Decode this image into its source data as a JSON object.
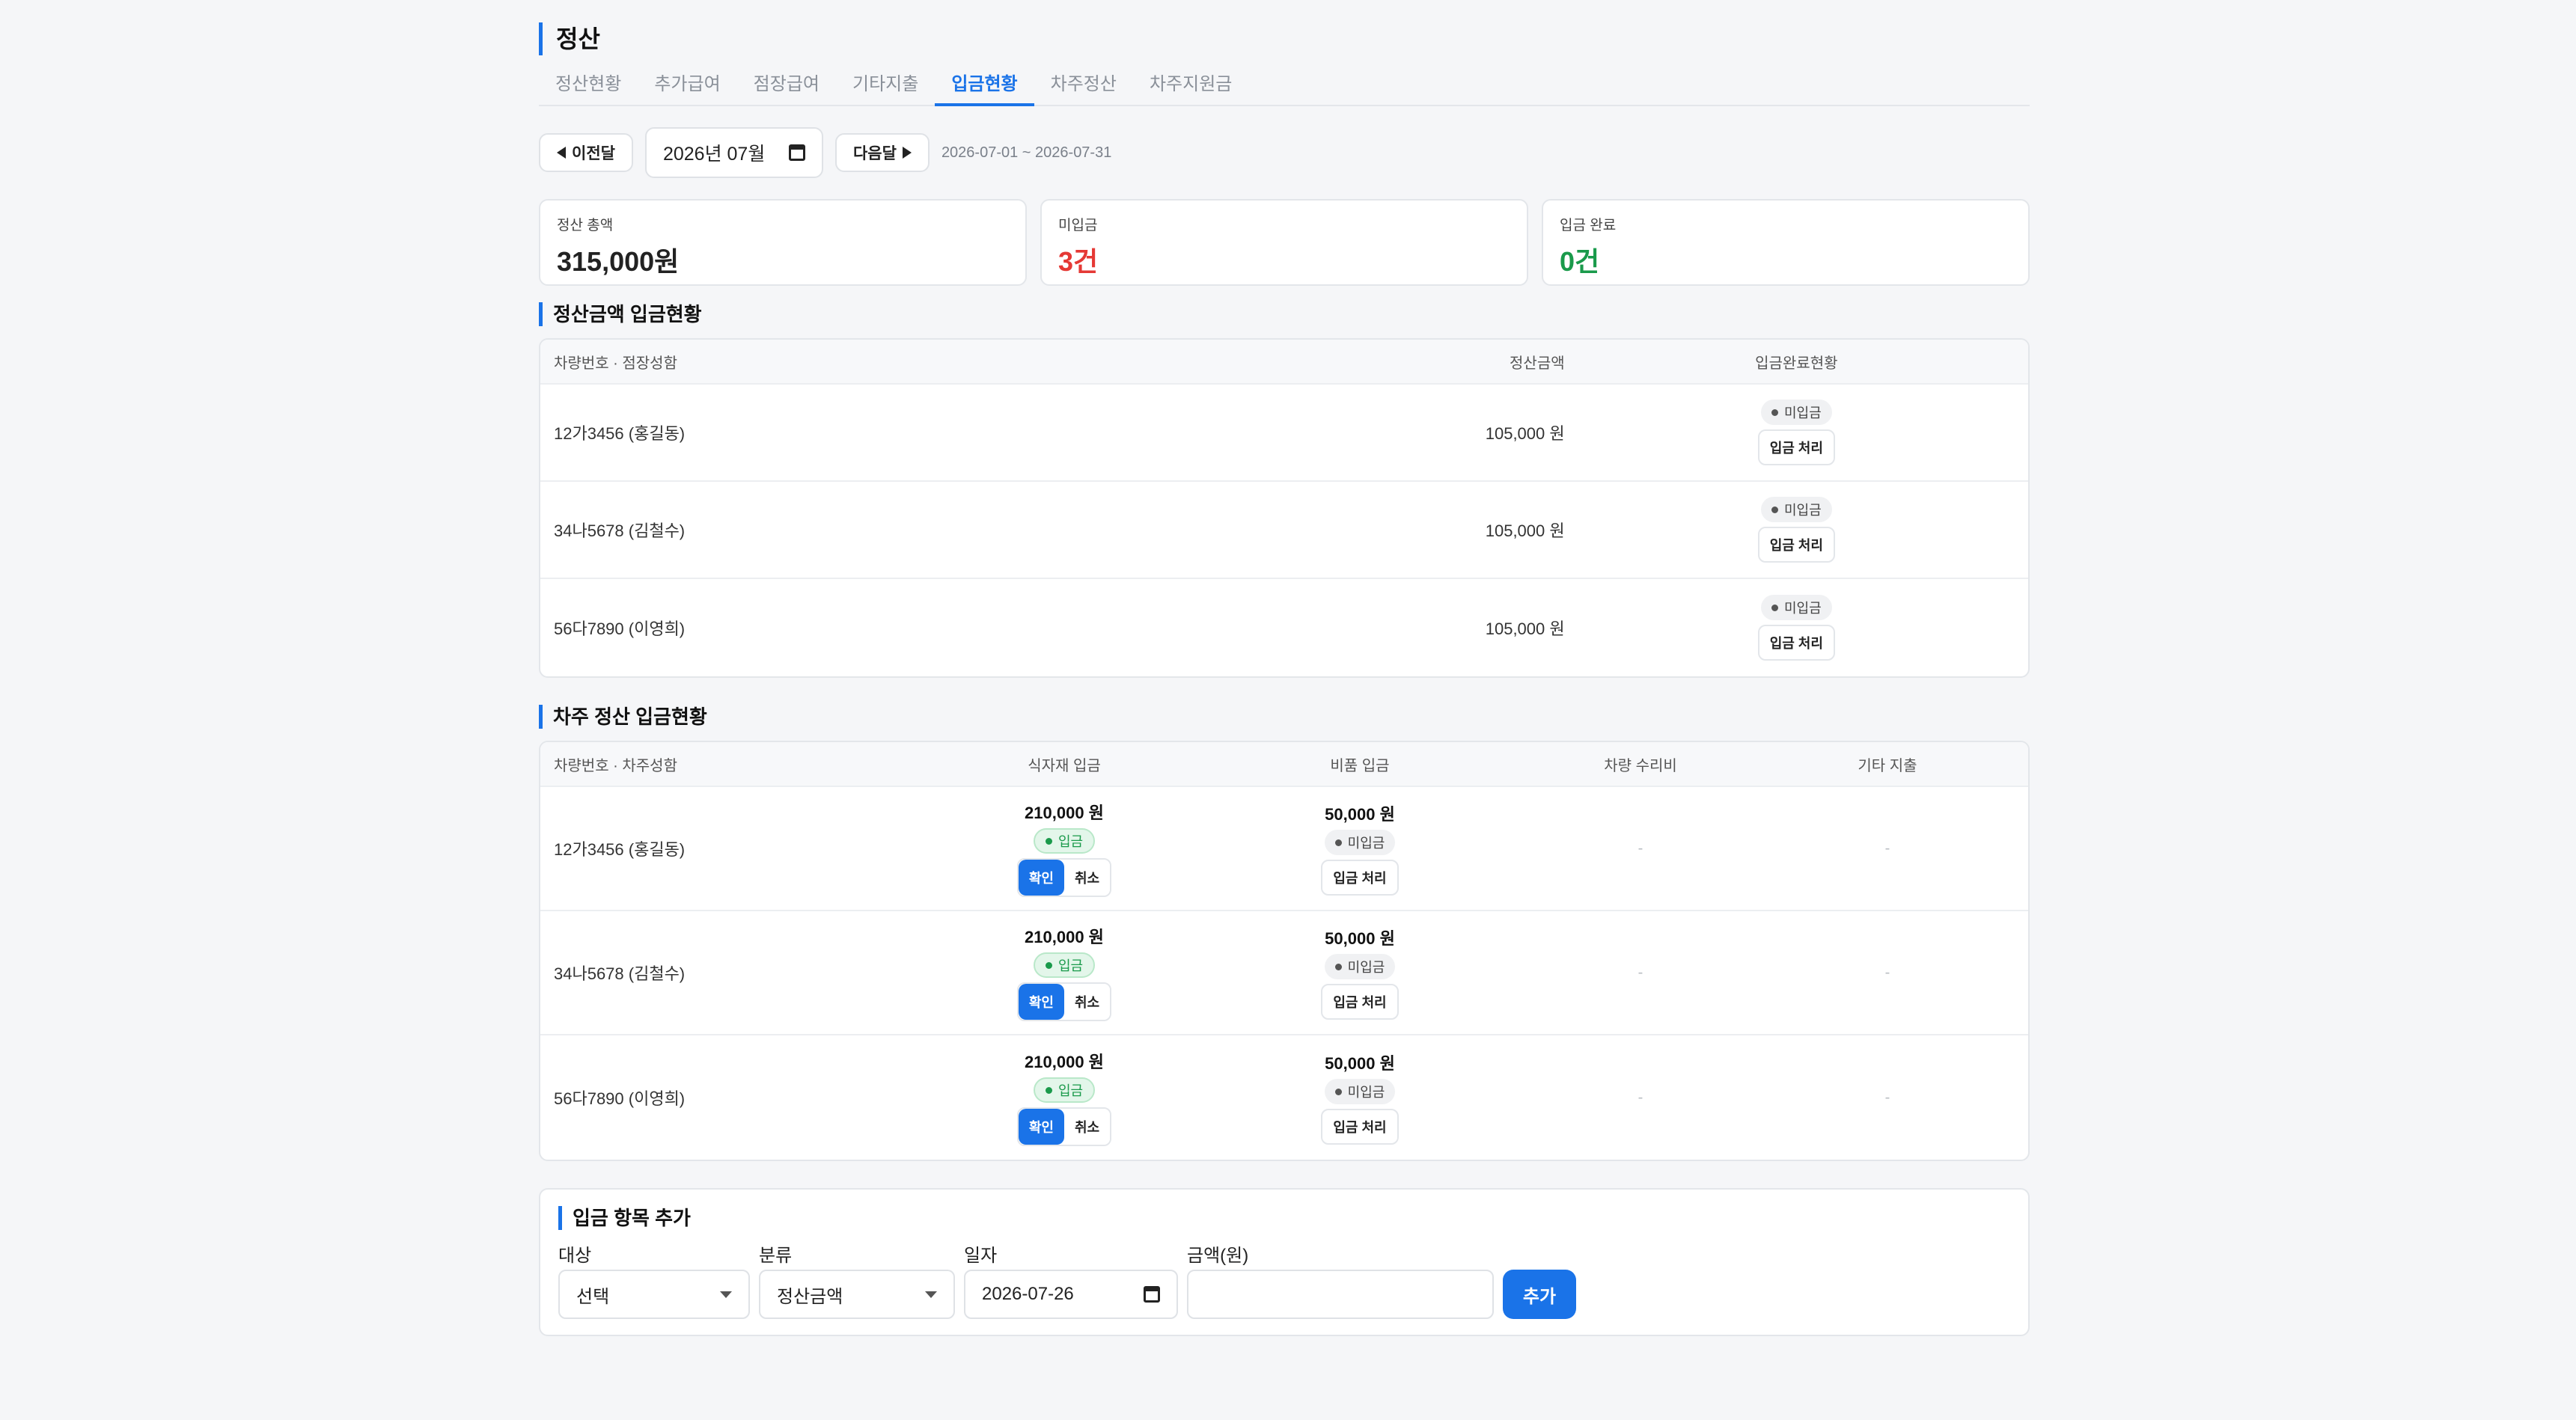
{
  "page": {
    "title": "정산"
  },
  "tabs": [
    {
      "label": "정산현황"
    },
    {
      "label": "추가급여"
    },
    {
      "label": "점장급여"
    },
    {
      "label": "기타지출"
    },
    {
      "label": "입금현황"
    },
    {
      "label": "차주정산"
    },
    {
      "label": "차주지원금"
    }
  ],
  "active_tab": "입금현황",
  "period": {
    "prev_label": "이전달",
    "next_label": "다음달",
    "month_value": "2026년 07월",
    "range": "2026-07-01 ~ 2026-07-31"
  },
  "summary": {
    "total": {
      "label": "정산 총액",
      "value": "315,000원"
    },
    "unpaid": {
      "label": "미입금",
      "value": "3건",
      "color": "#e53935"
    },
    "paid": {
      "label": "입금 완료",
      "value": "0건",
      "color": "#1a9a4b"
    }
  },
  "settlement_table": {
    "title": "정산금액 입금현황",
    "columns": [
      "차량번호 · 점장성함",
      "정산금액",
      "입금완료현황"
    ],
    "rows": [
      {
        "vehicle": "12가3456 (홍길동)",
        "amount": "105,000 원",
        "status": "미입금",
        "action": "입금 처리"
      },
      {
        "vehicle": "34나5678 (김철수)",
        "amount": "105,000 원",
        "status": "미입금",
        "action": "입금 처리"
      },
      {
        "vehicle": "56다7890 (이영희)",
        "amount": "105,000 원",
        "status": "미입금",
        "action": "입금 처리"
      }
    ]
  },
  "owner_table": {
    "title": "차주 정산 입금현황",
    "columns": [
      "차량번호 · 차주성함",
      "식자재 입금",
      "비품 입금",
      "차량 수리비",
      "기타 지출"
    ],
    "rows": [
      {
        "vehicle": "12가3456 (홍길동)",
        "food": {
          "amount": "210,000 원",
          "status": "입금",
          "confirm": "확인",
          "cancel": "취소"
        },
        "supplies": {
          "amount": "50,000 원",
          "status": "미입금",
          "action": "입금 처리"
        },
        "repair": "-",
        "other": "-"
      },
      {
        "vehicle": "34나5678 (김철수)",
        "food": {
          "amount": "210,000 원",
          "status": "입금",
          "confirm": "확인",
          "cancel": "취소"
        },
        "supplies": {
          "amount": "50,000 원",
          "status": "미입금",
          "action": "입금 처리"
        },
        "repair": "-",
        "other": "-"
      },
      {
        "vehicle": "56다7890 (이영희)",
        "food": {
          "amount": "210,000 원",
          "status": "입금",
          "confirm": "확인",
          "cancel": "취소"
        },
        "supplies": {
          "amount": "50,000 원",
          "status": "미입금",
          "action": "입금 처리"
        },
        "repair": "-",
        "other": "-"
      }
    ]
  },
  "add_form": {
    "title": "입금 항목 추가",
    "target": {
      "label": "대상",
      "value": "선택"
    },
    "category": {
      "label": "분류",
      "value": "정산금액"
    },
    "date": {
      "label": "일자",
      "value": "2026-07-26"
    },
    "amount": {
      "label": "금액(원)",
      "value": ""
    },
    "submit_label": "추가"
  },
  "colors": {
    "accent": "#1a73e8",
    "danger": "#e53935",
    "success": "#1a9a4b"
  }
}
